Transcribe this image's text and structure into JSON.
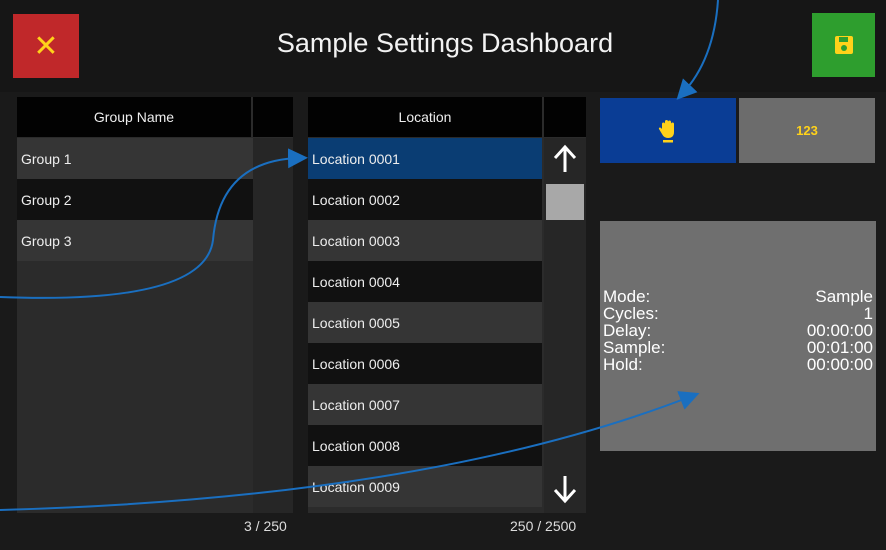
{
  "header": {
    "title": "Sample Settings Dashboard",
    "close_icon": "close-icon",
    "save_icon": "save-icon"
  },
  "groups": {
    "column_header": "Group Name",
    "items": [
      "Group 1",
      "Group 2",
      "Group 3"
    ],
    "count": "3 / 250"
  },
  "locations": {
    "column_header": "Location",
    "items": [
      "Location 0001",
      "Location 0002",
      "Location 0003",
      "Location 0004",
      "Location 0005",
      "Location 0006",
      "Location 0007",
      "Location 0008",
      "Location 0009"
    ],
    "selected": "Location 0001",
    "count": "250 / 2500"
  },
  "mode_buttons": {
    "manual_icon": "hand-icon",
    "numeric_label": "123"
  },
  "info": {
    "rows": [
      {
        "label": "Mode:",
        "value": "Sample"
      },
      {
        "label": "Cycles:",
        "value": "1"
      },
      {
        "label": "Delay:",
        "value": "00:00:00"
      },
      {
        "label": "Sample:",
        "value": "00:01:00"
      },
      {
        "label": "Hold:",
        "value": "00:00:00"
      }
    ]
  },
  "colors": {
    "close": "#c0282a",
    "save": "#2e9e2e",
    "selected_row": "#0a3d73",
    "manual_button": "#0a3d95",
    "icon_yellow": "#ffd21a",
    "annotation_arrow": "#1a6fc0"
  }
}
